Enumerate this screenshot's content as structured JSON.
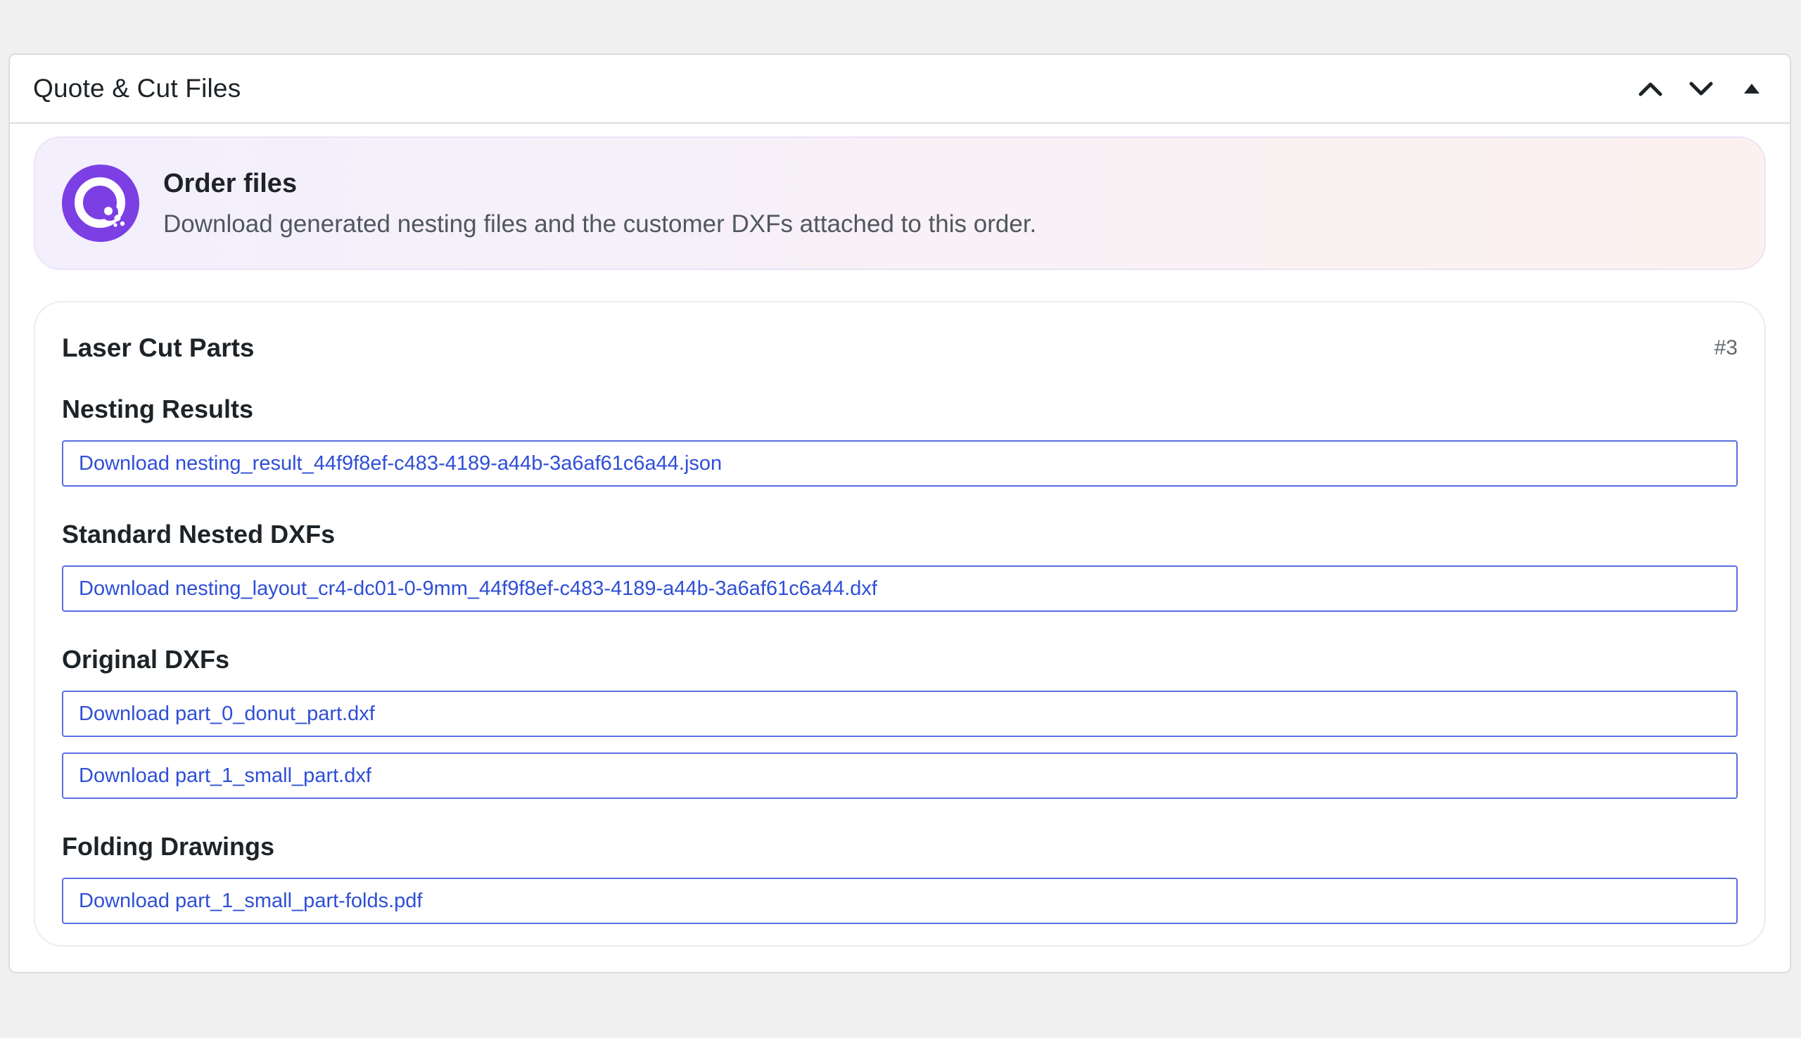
{
  "panel": {
    "title": "Quote & Cut Files"
  },
  "banner": {
    "title": "Order files",
    "description": "Download generated nesting files and the customer DXFs attached to this order."
  },
  "card": {
    "title": "Laser Cut Parts",
    "count": "#3"
  },
  "sections": [
    {
      "title": "Nesting Results",
      "links": [
        "Download nesting_result_44f9f8ef-c483-4189-a44b-3a6af61c6a44.json"
      ]
    },
    {
      "title": "Standard Nested DXFs",
      "links": [
        "Download nesting_layout_cr4-dc01-0-9mm_44f9f8ef-c483-4189-a44b-3a6af61c6a44.dxf"
      ]
    },
    {
      "title": "Original DXFs",
      "links": [
        "Download part_0_donut_part.dxf",
        "Download part_1_small_part.dxf"
      ]
    },
    {
      "title": "Folding Drawings",
      "links": [
        "Download part_1_small_part-folds.pdf"
      ]
    }
  ],
  "icons": {
    "move_up": "chevron-up-icon",
    "move_down": "chevron-down-icon",
    "toggle": "caret-up-icon",
    "logo": "quote-logo-icon"
  },
  "colors": {
    "accent": "#7b3fe4",
    "link": "#2f4fd6",
    "link_border": "#5b6ee1"
  }
}
